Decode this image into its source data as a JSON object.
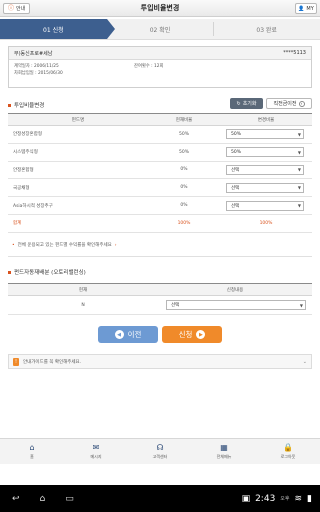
{
  "header": {
    "guide_label": "안내",
    "title": "투입비율변경",
    "my_label": "MY"
  },
  "steps": [
    {
      "label": "01 신청"
    },
    {
      "label": "02 확인"
    },
    {
      "label": "03 완료"
    }
  ],
  "account": {
    "name": "무)동신프로#세남",
    "number": "****5113",
    "contract_date_label": "계약일자 : 2006/11/25",
    "payment_label": "잔여횟수 : 12회",
    "next_payment_label": "차회납입일 : 2015/06/30"
  },
  "fund_section": {
    "title": "투입비율변경",
    "reset_label": "초기화",
    "prev_ratio_label": "직전금이전",
    "columns": [
      "펀드명",
      "현재비율",
      "변경비율"
    ],
    "rows": [
      {
        "name": "안정성장혼합형",
        "current": "50%",
        "new": "50%"
      },
      {
        "name": "시스템주식형",
        "current": "50%",
        "new": "50%"
      },
      {
        "name": "안정혼합형",
        "current": "0%",
        "new": "선택"
      },
      {
        "name": "국공채형",
        "current": "0%",
        "new": "선택"
      },
      {
        "name": "Asia하시적 성장추구",
        "current": "0%",
        "new": "선택"
      }
    ],
    "total": {
      "label": "합계",
      "current": "100%",
      "new": "100%"
    },
    "notice": "전체 운용되고 있는 펀드별 수익률을 확인해주세요"
  },
  "rebalance_section": {
    "title": "펀드자동재배분 (오토리밸런싱)",
    "columns": [
      "현재",
      "신청내용"
    ],
    "row": {
      "current": "N",
      "select": "선택"
    }
  },
  "buttons": {
    "back_label": "이전",
    "apply_label": "신청"
  },
  "notice_bar": {
    "text": "안내가이드를 꼭 확인해주세요."
  },
  "bottom_nav": [
    {
      "label": "홈",
      "icon": "home-icon"
    },
    {
      "label": "메시지",
      "icon": "message-icon"
    },
    {
      "label": "고객센터",
      "icon": "headset-icon"
    },
    {
      "label": "전체메뉴",
      "icon": "grid-icon"
    },
    {
      "label": "로그아웃",
      "icon": "lock-icon"
    }
  ],
  "system": {
    "time": "2:43",
    "ampm": "오후"
  },
  "colors": {
    "step_active": "#3d5f8f",
    "accent": "#d9531e",
    "back_button": "#6d9ad3",
    "apply_button": "#f08a2a"
  }
}
